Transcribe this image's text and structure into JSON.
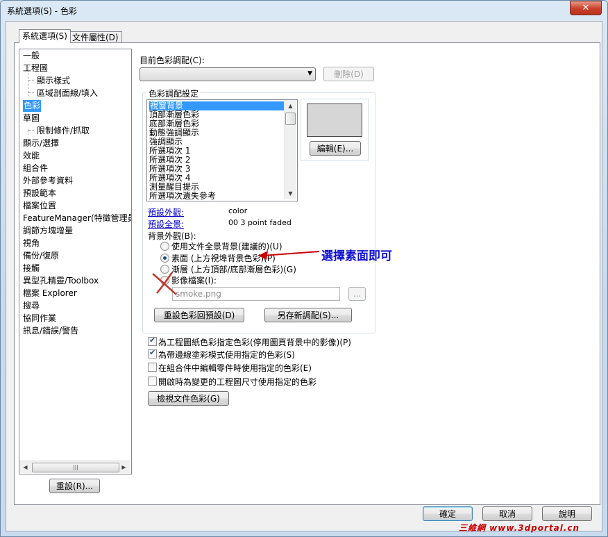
{
  "window": {
    "title": "系統選項(S) - 色彩",
    "close_glyph": "✕"
  },
  "tabs": [
    {
      "label": "系統選項(S)",
      "active": true
    },
    {
      "label": "文件屬性(D)",
      "active": false
    }
  ],
  "tree": {
    "items": [
      {
        "label": "一般",
        "level": 0
      },
      {
        "label": "工程圖",
        "level": 0
      },
      {
        "label": "顯示樣式",
        "level": 1
      },
      {
        "label": "區域剖面線/填入",
        "level": 1
      },
      {
        "label": "色彩",
        "level": 0,
        "selected": true
      },
      {
        "label": "草圖",
        "level": 0
      },
      {
        "label": "限制條件/抓取",
        "level": 1
      },
      {
        "label": "顯示/選擇",
        "level": 0
      },
      {
        "label": "效能",
        "level": 0
      },
      {
        "label": "組合件",
        "level": 0
      },
      {
        "label": "外部參考資料",
        "level": 0
      },
      {
        "label": "預設範本",
        "level": 0
      },
      {
        "label": "檔案位置",
        "level": 0
      },
      {
        "label": "FeatureManager(特徵管理員)",
        "level": 0
      },
      {
        "label": "調節方塊增量",
        "level": 0
      },
      {
        "label": "視角",
        "level": 0
      },
      {
        "label": "備份/復原",
        "level": 0
      },
      {
        "label": "接觸",
        "level": 0
      },
      {
        "label": "異型孔精靈/Toolbox",
        "level": 0
      },
      {
        "label": "檔案 Explorer",
        "level": 0
      },
      {
        "label": "搜尋",
        "level": 0
      },
      {
        "label": "協同作業",
        "level": 0
      },
      {
        "label": "訊息/錯誤/警告",
        "level": 0
      }
    ],
    "scroll_left": "◀",
    "scroll_right": "▶",
    "scroll_grip": "|||",
    "reset_label": "重設(R)..."
  },
  "scheme": {
    "label": "目前色彩調配(C):",
    "value": "",
    "arrow": "▼",
    "delete_label": "刪除(D)"
  },
  "color_settings": {
    "group_title": "色彩調配設定",
    "items": [
      {
        "label": "視窗背景",
        "selected": true
      },
      {
        "label": "頂部漸層色彩"
      },
      {
        "label": "底部漸層色彩"
      },
      {
        "label": "動態強調顯示"
      },
      {
        "label": "強調顯示"
      },
      {
        "label": "所選項次 1"
      },
      {
        "label": "所選項次 2"
      },
      {
        "label": "所選項次 3"
      },
      {
        "label": "所選項次 4"
      },
      {
        "label": "測量醒目提示"
      },
      {
        "label": "所選項次遺失參考"
      }
    ],
    "scroll_up": "▲",
    "scroll_down": "▼",
    "preview_color": "#d6d6d6",
    "edit_label": "編輯(E)...",
    "default_appearance_label": "預設外觀:",
    "default_appearance_value": "color",
    "default_scene_label": "預設全景:",
    "default_scene_value": "00 3 point faded",
    "bg_appearance_label": "背景外觀(B):",
    "bg_options": [
      {
        "label": "使用文件全景背景(建議的)(U)",
        "checked": false
      },
      {
        "label": "素面 (上方視埠背景色彩)(P)",
        "checked": true
      },
      {
        "label": "漸層 (上方頂部/底部漸層色彩)(G)",
        "checked": false
      },
      {
        "label": "影像檔案(I):",
        "checked": false
      }
    ],
    "image_file_value": "smoke.png",
    "browse_label": "...",
    "reset_colors_label": "重設色彩回預設(D)",
    "save_scheme_label": "另存新調配(S)..."
  },
  "checkboxes": [
    {
      "label": "為工程圖紙色彩指定色彩(停用圖頁背景中的影像)(P)",
      "checked": true
    },
    {
      "label": "為帶邊線塗彩模式使用指定的色彩(S)",
      "checked": true
    },
    {
      "label": "在組合件中編輯零件時使用指定的色彩(E)",
      "checked": false
    },
    {
      "label": "開啟時為變更的工程圖尺寸使用指定的色彩",
      "checked": false
    }
  ],
  "view_doc_colors_label": "檢視文件色彩(G)",
  "annotation": {
    "text": "選擇素面即可",
    "color": "#1010d0",
    "arrow_color": "#cc0000"
  },
  "footer": {
    "ok_label": "確定",
    "cancel_label": "取消",
    "help_label": "說明"
  },
  "watermark": "三維網 www.3dportal.cn"
}
